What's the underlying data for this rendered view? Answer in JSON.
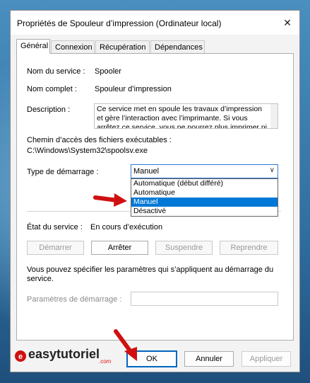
{
  "window": {
    "title": "Propriétés de Spouleur d’impression (Ordinateur local)",
    "close_glyph": "✕"
  },
  "tabs": [
    {
      "label": "Général",
      "active": true
    },
    {
      "label": "Connexion",
      "active": false
    },
    {
      "label": "Récupération",
      "active": false
    },
    {
      "label": "Dépendances",
      "active": false
    }
  ],
  "general": {
    "service_name_label": "Nom du service :",
    "service_name_value": "Spooler",
    "display_name_label": "Nom complet :",
    "display_name_value": "Spouleur d’impression",
    "description_label": "Description :",
    "description_lines": [
      "Ce service met en spoule les travaux d’impression",
      "et gère l’interaction avec l’imprimante. Si vous",
      "arrêtez ce service, vous ne pourrez plus imprimer ni"
    ],
    "path_label": "Chemin d’accès des fichiers exécutables :",
    "path_value": "C:\\Windows\\System32\\spoolsv.exe",
    "startup_type_label": "Type de démarrage :",
    "startup_type_selected": "Manuel",
    "startup_options": [
      "Automatique (début différé)",
      "Automatique",
      "Manuel",
      "Désactivé"
    ],
    "status_label": "État du service :",
    "status_value": "En cours d’exécution",
    "buttons": {
      "start": "Démarrer",
      "stop": "Arrêter",
      "pause": "Suspendre",
      "resume": "Reprendre"
    },
    "params_info": "Vous pouvez spécifier les paramètres qui s’appliquent au démarrage du",
    "params_info2": "service.",
    "params_label": "Paramètres de démarrage :",
    "params_value": ""
  },
  "footer": {
    "ok": "OK",
    "cancel": "Annuler",
    "apply": "Appliquer"
  },
  "watermark": {
    "text": "easytutoriel",
    "suffix": ".com"
  },
  "colors": {
    "accent": "#0078d7",
    "arrow": "#d01010"
  }
}
